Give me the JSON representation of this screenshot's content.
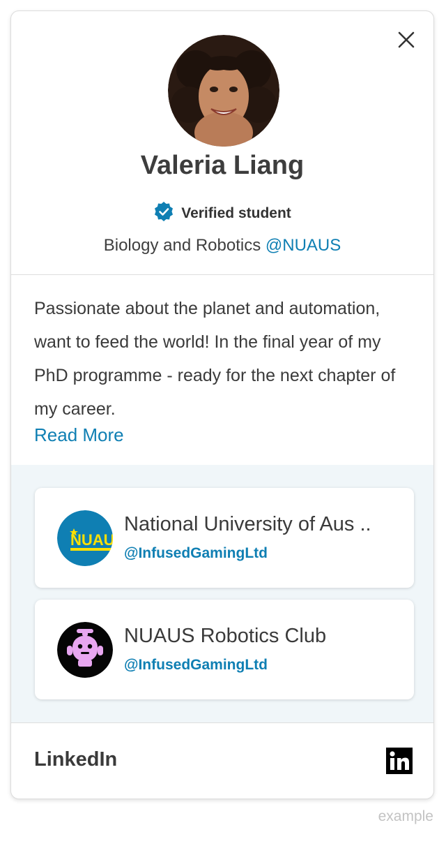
{
  "profile": {
    "name": "Valeria Liang",
    "verified_label": "Verified student",
    "subject": "Biology and Robotics",
    "institution_handle": "@NUAUS",
    "bio": "Passionate about the planet and automation, want to feed the world! In the final year of my PhD programme - ready for the next chapter of my career.",
    "read_more": "Read More"
  },
  "organizations": [
    {
      "name": "National University of Aus ..",
      "handle": "@InfusedGamingLtd",
      "logo_text": "NUAU",
      "icon": "university-logo"
    },
    {
      "name": "NUAUS Robotics Club",
      "handle": "@InfusedGamingLtd",
      "icon": "robot-logo"
    }
  ],
  "footer": {
    "label": "LinkedIn",
    "icon": "linkedin-icon"
  },
  "watermark": "example",
  "colors": {
    "accent": "#0f7fb3",
    "panel_bg": "#f0f6f9",
    "verified_badge": "#0f7fb3"
  }
}
